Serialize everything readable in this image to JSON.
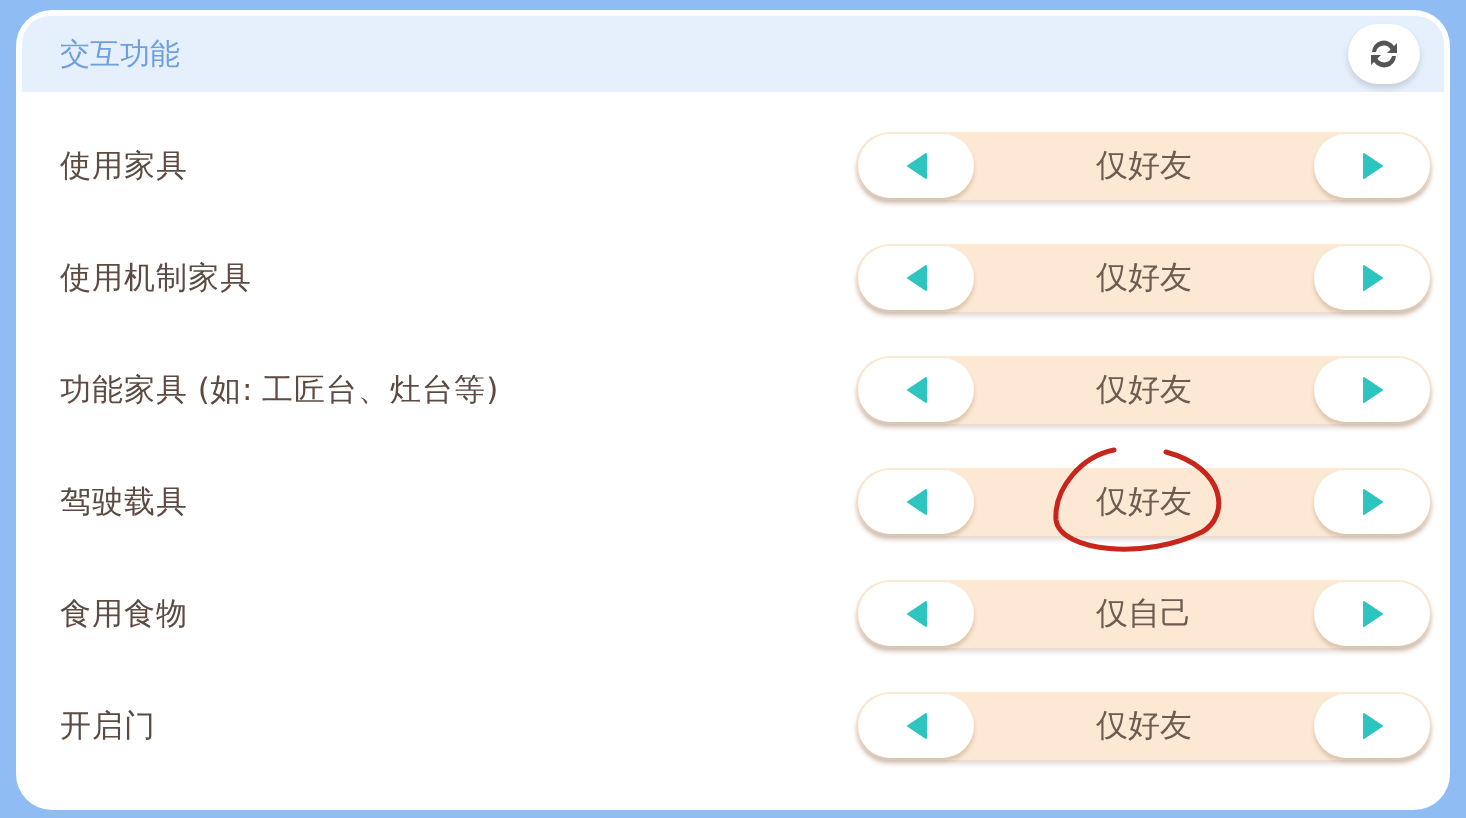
{
  "panel": {
    "title": "交互功能"
  },
  "rows": [
    {
      "label": "使用家具",
      "value": "仅好友",
      "annotated": false
    },
    {
      "label": "使用机制家具",
      "value": "仅好友",
      "annotated": false
    },
    {
      "label": "功能家具 (如: 工匠台、灶台等)",
      "value": "仅好友",
      "annotated": false
    },
    {
      "label": "驾驶载具",
      "value": "仅好友",
      "annotated": true
    },
    {
      "label": "食用食物",
      "value": "仅自己",
      "annotated": false
    },
    {
      "label": "开启门",
      "value": "仅好友",
      "annotated": false
    }
  ]
}
